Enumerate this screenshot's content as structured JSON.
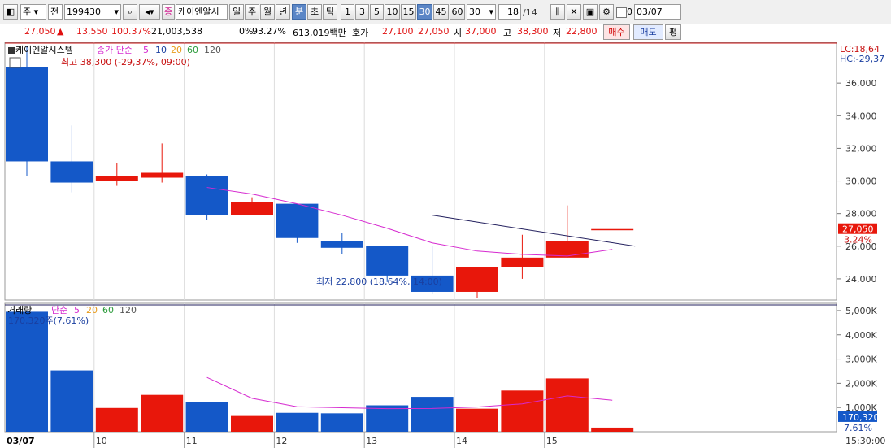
{
  "toolbar": {
    "type1": "주",
    "type2": "전",
    "code": "199430",
    "stock_icon_label": "종",
    "stock_name": "케이엔알시",
    "periods": [
      "일",
      "주",
      "월",
      "년",
      "분",
      "초",
      "틱"
    ],
    "selected_period": "분",
    "intervals": [
      "1",
      "3",
      "5",
      "10",
      "15",
      "30",
      "45",
      "60"
    ],
    "selected_interval": "30",
    "interval_select": "30",
    "count": "18",
    "count_total": "/14",
    "checkbox_label": "0",
    "date": "03/07"
  },
  "infobar": {
    "price": "27,050",
    "change": "13,550",
    "change_rate": "100.37%",
    "volume": "21,003,538",
    "pct1": "0%",
    "pct2": "93.27%",
    "amount": "613,019백만",
    "quote_label": "호가",
    "ask": "27,100",
    "bid": "27,050",
    "open_label": "시",
    "open": "37,000",
    "high_label": "고",
    "high": "38,300",
    "low_label": "저",
    "low": "22,800",
    "sell_button": "매수",
    "buy_button": "매도",
    "eval_button": "평"
  },
  "price_chart": {
    "legend_name": "케이엔알시스템",
    "legend_ma_label": "종가 단순",
    "ma_periods": [
      "5",
      "10",
      "20",
      "60",
      "120"
    ],
    "high_annotation": "최고 38,300 (-29,37%, 09:00)",
    "low_annotation": "최저 22,800 (18,64%, 14:00)",
    "lc_label": "LC:18,64",
    "hc_label": "HC:-29,37",
    "current_price_tag": "27,050",
    "current_rate_tag": "3.24%",
    "y_ticks": [
      "36,000",
      "34,000",
      "32,000",
      "30,000",
      "28,000",
      "26,000",
      "24,000"
    ]
  },
  "volume_chart": {
    "legend_name": "거래량",
    "legend_ma_label": "단순",
    "ma_periods": [
      "5",
      "20",
      "60",
      "120"
    ],
    "last_annotation": "170,320주(7,61%)",
    "current_volume_tag": "170,320",
    "current_rate_tag": "7.61%",
    "y_ticks": [
      "5,000K",
      "4,000K",
      "3,000K",
      "2,000K",
      "1,000K"
    ]
  },
  "time_axis": {
    "date_label": "03/07",
    "hour_labels": [
      "10",
      "11",
      "12",
      "13",
      "14",
      "15"
    ],
    "last_time": "15:30:00"
  },
  "colors": {
    "up": "#e8170b",
    "down": "#1458c8",
    "ma5": "#d62ad0",
    "trend": "#23205e"
  },
  "chart_data": {
    "type": "candlestick",
    "candles": [
      {
        "open": 37000,
        "high": 38300,
        "low": 30300,
        "close": 31200,
        "dir": "down"
      },
      {
        "open": 31200,
        "high": 33400,
        "low": 29300,
        "close": 29900,
        "dir": "down"
      },
      {
        "open": 30000,
        "high": 31100,
        "low": 29700,
        "close": 30300,
        "dir": "up"
      },
      {
        "open": 30200,
        "high": 32300,
        "low": 29900,
        "close": 30500,
        "dir": "up"
      },
      {
        "open": 30300,
        "high": 30400,
        "low": 27600,
        "close": 27900,
        "dir": "down"
      },
      {
        "open": 27900,
        "high": 29000,
        "low": 27900,
        "close": 28700,
        "dir": "up"
      },
      {
        "open": 28600,
        "high": 28600,
        "low": 26200,
        "close": 26500,
        "dir": "down"
      },
      {
        "open": 26300,
        "high": 26800,
        "low": 25500,
        "close": 25900,
        "dir": "down"
      },
      {
        "open": 26000,
        "high": 26000,
        "low": 23800,
        "close": 24200,
        "dir": "down"
      },
      {
        "open": 24200,
        "high": 26000,
        "low": 23100,
        "close": 23200,
        "dir": "down"
      },
      {
        "open": 23200,
        "high": 24700,
        "low": 22800,
        "close": 24700,
        "dir": "up"
      },
      {
        "open": 24700,
        "high": 26700,
        "low": 24000,
        "close": 25300,
        "dir": "up"
      },
      {
        "open": 25300,
        "high": 28500,
        "low": 25300,
        "close": 26300,
        "dir": "up"
      },
      {
        "open": 27050,
        "high": 27050,
        "low": 27050,
        "close": 27050,
        "dir": "up"
      }
    ],
    "ma5": [
      null,
      null,
      null,
      null,
      29600,
      29200,
      28600,
      27900,
      27100,
      26200,
      25700,
      25500,
      25400,
      25800
    ],
    "volume": [
      4950,
      2530,
      980,
      1520,
      1210,
      650,
      780,
      760,
      1090,
      1440,
      950,
      1700,
      2200,
      170
    ],
    "volume_ma5": [
      null,
      null,
      null,
      null,
      2240,
      1380,
      1030,
      990,
      950,
      960,
      1020,
      1150,
      1480,
      1300
    ],
    "trend_line": [
      [
        9,
        27900
      ],
      [
        13,
        26000
      ]
    ],
    "price_ylim": [
      22700,
      38500
    ],
    "volume_ylim": [
      0,
      5300
    ]
  }
}
